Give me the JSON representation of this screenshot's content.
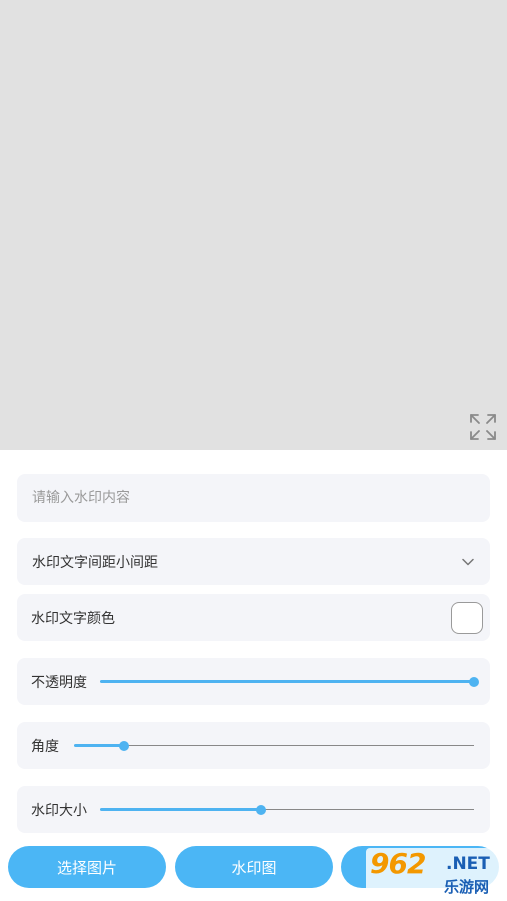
{
  "preview": {
    "expand_icon": "expand-arrows-icon"
  },
  "watermark_input": {
    "placeholder": "请输入水印内容",
    "value": ""
  },
  "spacing": {
    "value": "水印文字间距小间距",
    "icon": "chevron-down-icon"
  },
  "text_color": {
    "label": "水印文字颜色",
    "value": "#ffffff"
  },
  "opacity": {
    "label": "不透明度",
    "level": 1.0
  },
  "angle": {
    "label": "角度",
    "level": 0.125
  },
  "size": {
    "label": "水印大小",
    "level": 0.43
  },
  "buttons": {
    "select_image": "选择图片",
    "watermark_image": "水印图"
  },
  "logo": {
    "big": "962",
    "net": ".NET",
    "sub": "乐游网"
  },
  "colors": {
    "accent": "#4bb6f5",
    "panel_bg": "#f4f5f9",
    "preview_bg": "#e1e1e1"
  }
}
